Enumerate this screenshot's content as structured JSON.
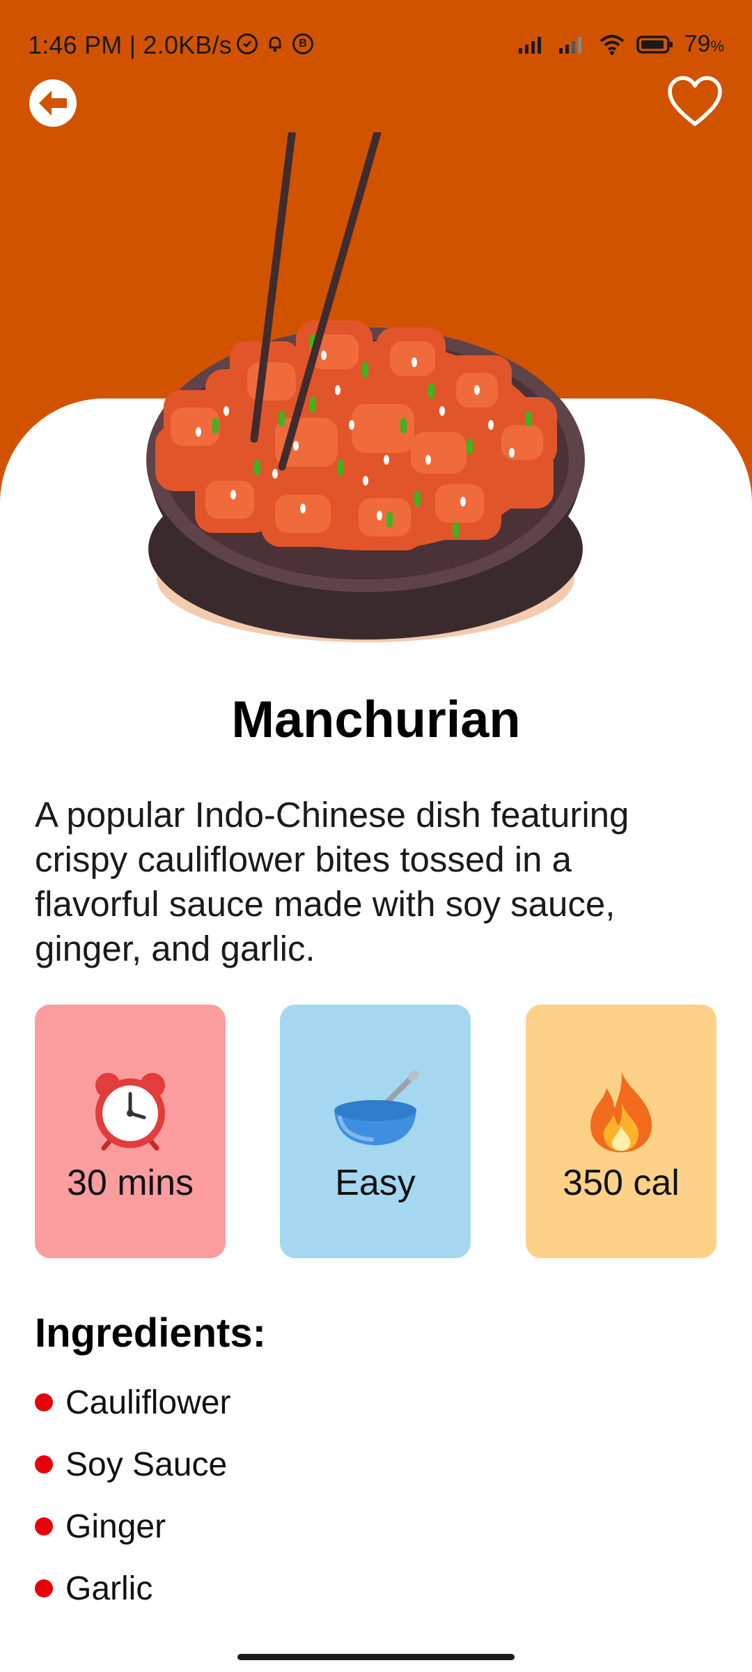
{
  "status_bar": {
    "time": "1:46 PM | 2.0KB/s",
    "battery_percent": "79",
    "battery_unit": "%"
  },
  "colors": {
    "header_bg": "#D15300",
    "time_card": "#FB9C9F",
    "difficulty_card": "#A5D8F0",
    "calories_card": "#FDD288",
    "bullet": "#E8000B"
  },
  "nav": {
    "back_icon": "arrow-left-circle-icon",
    "favorite_icon": "heart-outline-icon"
  },
  "recipe": {
    "title": "Manchurian",
    "description": "A popular Indo-Chinese dish featuring crispy cauliflower bites tossed in a flavorful sauce made with soy sauce, ginger, and garlic.",
    "stats": {
      "time": "30 mins",
      "difficulty": "Easy",
      "calories": "350 cal"
    },
    "ingredients_title": "Ingredients:",
    "ingredients": [
      "Cauliflower",
      "Soy Sauce",
      "Ginger",
      "Garlic"
    ]
  }
}
